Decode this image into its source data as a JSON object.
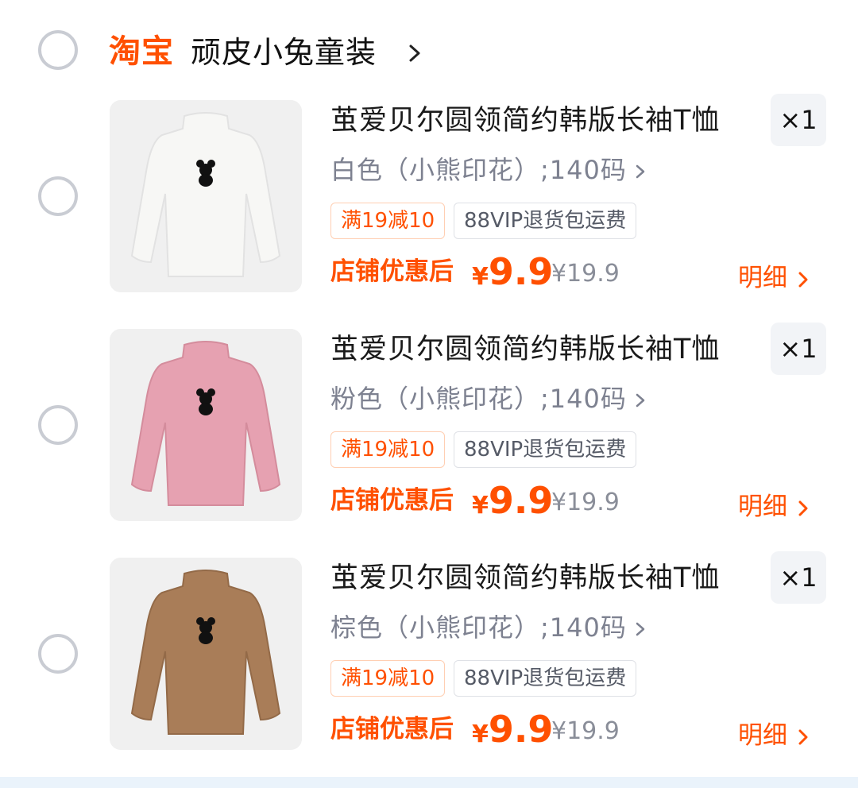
{
  "shop": {
    "logo": "淘宝",
    "name": "顽皮小兔童装"
  },
  "items": [
    {
      "title": "茧爱贝尔圆领简约韩版长袖T恤",
      "spec": "白色（小熊印花）;140码",
      "quantity": "×1",
      "tags": [
        "满19减10",
        "88VIP退货包运费"
      ],
      "price_label": "店铺优惠后",
      "currency": "¥",
      "price": "9.9",
      "original_price": "¥19.9",
      "detail_label": "明细",
      "shirt_color": "#f7f7f5"
    },
    {
      "title": "茧爱贝尔圆领简约韩版长袖T恤",
      "spec": "粉色（小熊印花）;140码",
      "quantity": "×1",
      "tags": [
        "满19减10",
        "88VIP退货包运费"
      ],
      "price_label": "店铺优惠后",
      "currency": "¥",
      "price": "9.9",
      "original_price": "¥19.9",
      "detail_label": "明细",
      "shirt_color": "#e6a1b1"
    },
    {
      "title": "茧爱贝尔圆领简约韩版长袖T恤",
      "spec": "棕色（小熊印花）;140码",
      "quantity": "×1",
      "tags": [
        "满19减10",
        "88VIP退货包运费"
      ],
      "price_label": "店铺优惠后",
      "currency": "¥",
      "price": "9.9",
      "original_price": "¥19.9",
      "detail_label": "明细",
      "shirt_color": "#a97d58"
    }
  ],
  "colors": {
    "accent": "#ff5000",
    "radio_border": "#c9ccd3",
    "muted_text": "#7d8190"
  },
  "icons": {
    "radio": "radio-unchecked-icon",
    "chevron": "chevron-right-icon",
    "bear": "bear-print-icon"
  }
}
